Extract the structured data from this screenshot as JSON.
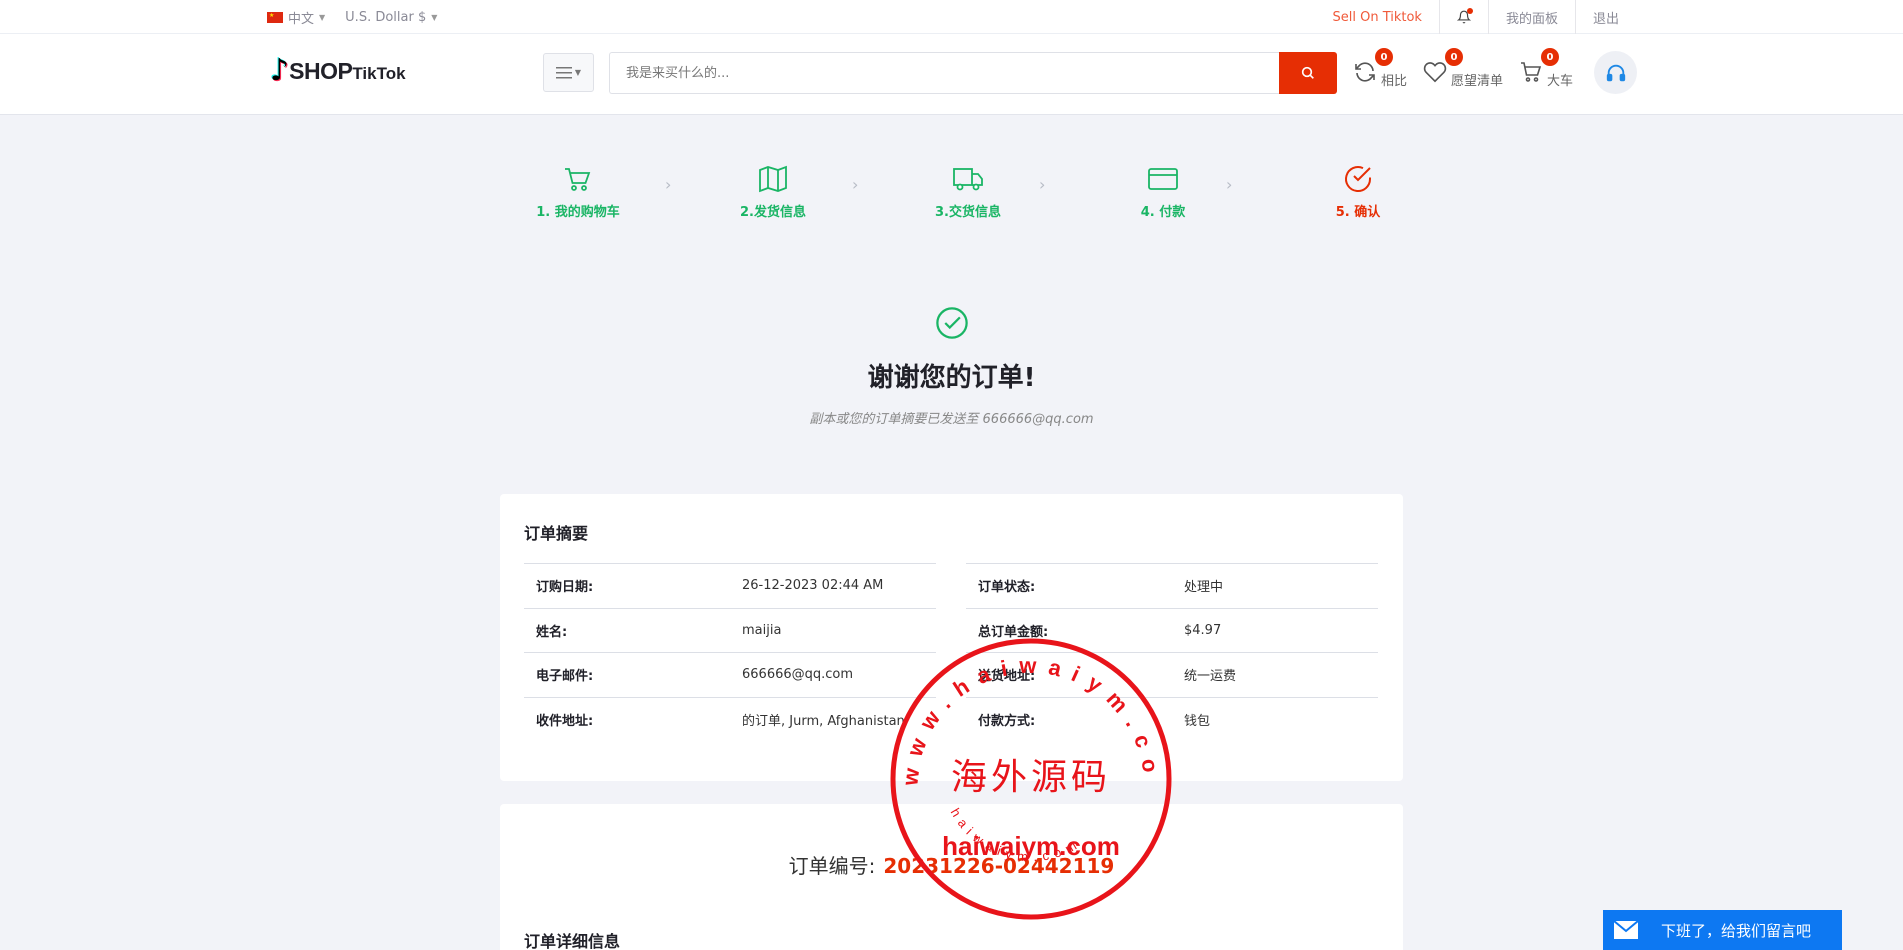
{
  "topbar": {
    "language": "中文",
    "currency": "U.S. Dollar $",
    "sell_link": "Sell On Tiktok",
    "dashboard": "我的面板",
    "logout": "退出"
  },
  "header": {
    "logo_shop": "SHOP",
    "logo_tiktok": "TikTok",
    "search_placeholder": "我是来买什么的...",
    "compare": {
      "label": "相比",
      "count": "0"
    },
    "wishlist": {
      "label": "愿望清单",
      "count": "0"
    },
    "cart": {
      "label": "大车",
      "count": "0"
    }
  },
  "steps": [
    {
      "label": "1. 我的购物车",
      "icon": "cart-icon"
    },
    {
      "label": "2.发货信息",
      "icon": "map-icon"
    },
    {
      "label": "3.交货信息",
      "icon": "truck-icon"
    },
    {
      "label": "4. 付款",
      "icon": "credit-card-icon"
    },
    {
      "label": "5. 确认",
      "icon": "check-circle-icon"
    }
  ],
  "thanks": {
    "title": "谢谢您的订单!",
    "subtitle": "副本或您的订单摘要已发送至 666666@qq.com"
  },
  "summary": {
    "title": "订单摘要",
    "left": [
      {
        "key": "订购日期:",
        "value": "26-12-2023 02:44 AM"
      },
      {
        "key": "姓名:",
        "value": "maijia"
      },
      {
        "key": "电子邮件:",
        "value": "666666@qq.com"
      },
      {
        "key": "收件地址:",
        "value": "的订单, Jurm, Afghanistan"
      }
    ],
    "right": [
      {
        "key": "订单状态:",
        "value": "处理中"
      },
      {
        "key": "总订单金额:",
        "value": "$4.97"
      },
      {
        "key": "送货地址:",
        "value": "统一运费"
      },
      {
        "key": "付款方式:",
        "value": "钱包"
      }
    ]
  },
  "order": {
    "code_label": "订单编号:",
    "code_value": "20231226-02442119",
    "details_title": "订单详细信息"
  },
  "stamp": {
    "ring_text": "www.haiwaiym.com",
    "center_text": "海外源码",
    "domain_text": "haiwaiym.com",
    "small_text": "haiwaiym.com"
  },
  "chat": {
    "label": "下班了，给我们留言吧"
  },
  "colors": {
    "accent": "#e62e04",
    "success": "#1ab565",
    "chat": "#0d78f2"
  }
}
